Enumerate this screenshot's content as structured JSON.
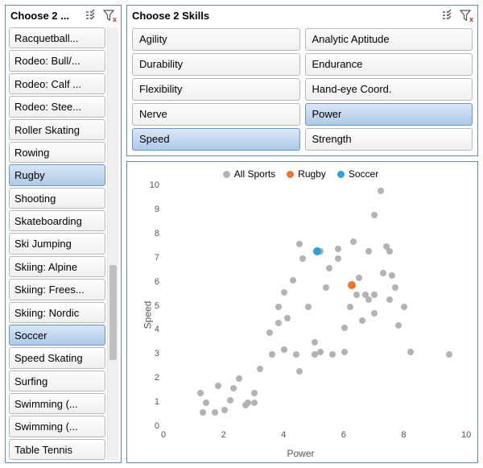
{
  "sports_panel": {
    "title": "Choose 2 ...",
    "items": [
      "Racquetball...",
      "Rodeo: Bull/...",
      "Rodeo: Calf ...",
      "Rodeo: Stee...",
      "Roller Skating",
      "Rowing",
      "Rugby",
      "Shooting",
      "Skateboarding",
      "Ski Jumping",
      "Skiing: Alpine",
      "Skiing: Frees...",
      "Skiing: Nordic",
      "Soccer",
      "Speed Skating",
      "Surfing",
      "Swimming (...",
      "Swimming (...",
      "Table Tennis"
    ],
    "selected": [
      "Rugby",
      "Soccer"
    ]
  },
  "skills_panel": {
    "title": "Choose 2 Skills",
    "items": [
      "Agility",
      "Analytic Aptitude",
      "Durability",
      "Endurance",
      "Flexibility",
      "Hand-eye Coord.",
      "Nerve",
      "Power",
      "Speed",
      "Strength"
    ],
    "selected": [
      "Power",
      "Speed"
    ]
  },
  "legend": {
    "all": "All Sports",
    "hl1": "Rugby",
    "hl2": "Soccer"
  },
  "colors": {
    "all": "#b3b3b3",
    "hl1": "#e8772e",
    "hl2": "#2e9fd8"
  },
  "chart_data": {
    "type": "scatter",
    "title": "",
    "xlabel": "Power",
    "ylabel": "Speed",
    "xlim": [
      0,
      10
    ],
    "ylim": [
      0,
      10
    ],
    "xticks": [
      0,
      2,
      4,
      6,
      8,
      10
    ],
    "yticks": [
      0,
      1,
      2,
      3,
      4,
      5,
      6,
      7,
      8,
      9,
      10
    ],
    "series": [
      {
        "name": "All Sports",
        "color": "#b3b3b3",
        "points": [
          [
            1.2,
            1.4
          ],
          [
            1.3,
            0.6
          ],
          [
            1.4,
            1.0
          ],
          [
            1.7,
            0.6
          ],
          [
            1.8,
            1.7
          ],
          [
            2.0,
            0.7
          ],
          [
            2.2,
            1.1
          ],
          [
            2.3,
            1.6
          ],
          [
            2.5,
            2.0
          ],
          [
            2.7,
            0.9
          ],
          [
            2.8,
            1.0
          ],
          [
            3.0,
            1.4
          ],
          [
            3.0,
            1.0
          ],
          [
            3.2,
            2.4
          ],
          [
            3.5,
            3.9
          ],
          [
            3.6,
            3.0
          ],
          [
            3.8,
            4.3
          ],
          [
            3.8,
            5.0
          ],
          [
            4.0,
            3.2
          ],
          [
            4.0,
            5.6
          ],
          [
            4.1,
            4.5
          ],
          [
            4.3,
            6.1
          ],
          [
            4.4,
            3.0
          ],
          [
            4.5,
            2.3
          ],
          [
            4.5,
            7.6
          ],
          [
            4.6,
            7.0
          ],
          [
            4.8,
            5.0
          ],
          [
            5.0,
            3.5
          ],
          [
            5.0,
            3.0
          ],
          [
            5.2,
            3.1
          ],
          [
            5.2,
            7.3
          ],
          [
            5.4,
            5.8
          ],
          [
            5.5,
            6.6
          ],
          [
            5.6,
            3.0
          ],
          [
            5.8,
            7.0
          ],
          [
            5.8,
            7.4
          ],
          [
            6.0,
            4.1
          ],
          [
            6.0,
            3.1
          ],
          [
            6.2,
            5.0
          ],
          [
            6.3,
            7.7
          ],
          [
            6.4,
            5.5
          ],
          [
            6.5,
            6.2
          ],
          [
            6.6,
            4.4
          ],
          [
            6.7,
            5.5
          ],
          [
            6.8,
            5.3
          ],
          [
            6.8,
            7.3
          ],
          [
            7.0,
            4.7
          ],
          [
            7.0,
            5.5
          ],
          [
            7.0,
            8.8
          ],
          [
            7.2,
            9.8
          ],
          [
            7.3,
            6.4
          ],
          [
            7.4,
            7.5
          ],
          [
            7.5,
            5.3
          ],
          [
            7.5,
            7.3
          ],
          [
            7.6,
            6.3
          ],
          [
            7.7,
            5.8
          ],
          [
            7.8,
            4.2
          ],
          [
            8.0,
            5.0
          ],
          [
            8.2,
            3.1
          ],
          [
            9.5,
            3.0
          ]
        ]
      },
      {
        "name": "Rugby",
        "color": "#e8772e",
        "points": [
          [
            6.25,
            5.9
          ]
        ]
      },
      {
        "name": "Soccer",
        "color": "#2e9fd8",
        "points": [
          [
            5.1,
            7.3
          ]
        ]
      }
    ]
  }
}
